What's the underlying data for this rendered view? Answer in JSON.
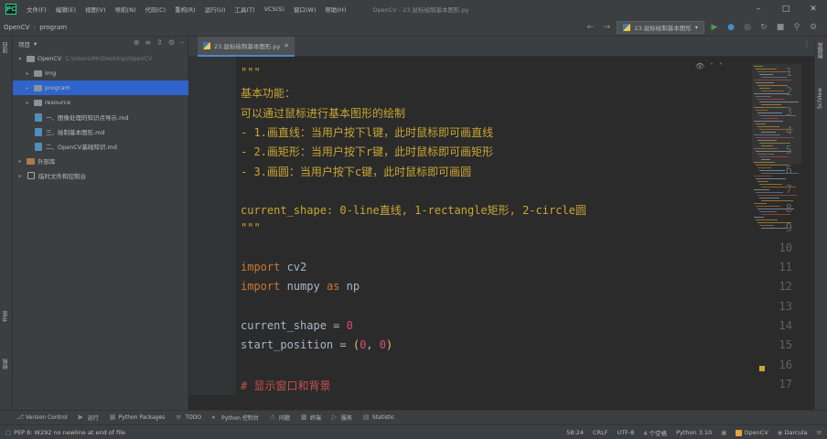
{
  "menubar": {
    "logo": "PC",
    "items": [
      "文件(F)",
      "编辑(E)",
      "视图(V)",
      "导航(N)",
      "代码(C)",
      "重构(R)",
      "运行(U)",
      "工具(T)",
      "VCS(S)",
      "窗口(W)",
      "帮助(H)"
    ],
    "title": "OpenCV - 23.鼠标绘制基本图形.py"
  },
  "navbar": {
    "crumbs": [
      "OpenCV",
      "program"
    ],
    "run_config": "23.鼠标绘制基本图形"
  },
  "project": {
    "header_label": "项目",
    "tree": [
      {
        "label": "OpenCV",
        "path": "C:\\Users\\Mr\\Desktop\\OpenCV",
        "type": "root"
      },
      {
        "label": "img",
        "type": "folder"
      },
      {
        "label": "program",
        "type": "folder"
      },
      {
        "label": "resource",
        "type": "folder"
      },
      {
        "label": "一、图像处理的知识点导示.md",
        "type": "md"
      },
      {
        "label": "三、绘制基本图形.md",
        "type": "md"
      },
      {
        "label": "二、OpenCV基础知识.md",
        "type": "md"
      },
      {
        "label": "外部库",
        "type": "lib"
      },
      {
        "label": "临时文件和控制台",
        "type": "scratch"
      }
    ]
  },
  "editor": {
    "tab_label": "23.鼠标绘制基本图形.py",
    "lines": [
      {
        "n": "1",
        "parts": [
          {
            "t": "\"\"\"",
            "c": "c-doc"
          }
        ]
      },
      {
        "n": "2",
        "parts": [
          {
            "t": "基本功能：",
            "c": "c-doc"
          }
        ]
      },
      {
        "n": "3",
        "parts": [
          {
            "t": "可以通过鼠标进行基本图形的绘制",
            "c": "c-doc"
          }
        ]
      },
      {
        "n": "4",
        "parts": [
          {
            "t": "- 1.画直线：当用户按下l键，此时鼠标即可画直线",
            "c": "c-doc"
          }
        ]
      },
      {
        "n": "5",
        "parts": [
          {
            "t": "- 2.画矩形：当用户按下r键，此时鼠标即可画矩形",
            "c": "c-doc"
          }
        ]
      },
      {
        "n": "6",
        "parts": [
          {
            "t": "- 3.画圆：当用户按下c键，此时鼠标即可画圆",
            "c": "c-doc"
          }
        ]
      },
      {
        "n": "7",
        "parts": []
      },
      {
        "n": "8",
        "parts": [
          {
            "t": "current_shape: 0-line直线, 1-rectangle矩形, 2-circle圆",
            "c": "c-doc"
          }
        ]
      },
      {
        "n": "9",
        "parts": [
          {
            "t": "\"\"\"",
            "c": "c-doc"
          }
        ]
      },
      {
        "n": "10",
        "parts": []
      },
      {
        "n": "11",
        "parts": [
          {
            "t": "import",
            "c": "c-kw"
          },
          {
            "t": " cv2",
            "c": "c-def"
          }
        ]
      },
      {
        "n": "12",
        "parts": [
          {
            "t": "import",
            "c": "c-kw"
          },
          {
            "t": " numpy ",
            "c": "c-def"
          },
          {
            "t": "as",
            "c": "c-kw"
          },
          {
            "t": " np",
            "c": "c-def"
          }
        ]
      },
      {
        "n": "13",
        "parts": []
      },
      {
        "n": "14",
        "parts": [
          {
            "t": "current_shape = ",
            "c": "c-def"
          },
          {
            "t": "0",
            "c": "c-numpink"
          }
        ]
      },
      {
        "n": "15",
        "parts": [
          {
            "t": "start_position = ",
            "c": "c-def"
          },
          {
            "t": "(",
            "c": "c-paren"
          },
          {
            "t": "0",
            "c": "c-numpink"
          },
          {
            "t": ", ",
            "c": "c-def"
          },
          {
            "t": "0",
            "c": "c-numpink"
          },
          {
            "t": ")",
            "c": "c-paren"
          }
        ]
      },
      {
        "n": "16",
        "parts": []
      },
      {
        "n": "17",
        "parts": [
          {
            "t": "# 显示窗口和背景",
            "c": "c-cm"
          }
        ]
      }
    ]
  },
  "bottombar": {
    "tools": [
      "Version Control",
      "运行",
      "Python Packages",
      "TODO",
      "Python 控制台",
      "问题",
      "终端",
      "服务",
      "Statistic"
    ]
  },
  "statusbar": {
    "message": "PEP 8: W292 no newline at end of file",
    "position": "58:24",
    "line_sep": "CRLF",
    "encoding": "UTF-8",
    "indent": "4 个空格",
    "interpreter": "Python 3.10",
    "project": "OpenCV",
    "theme": "Darcula"
  }
}
